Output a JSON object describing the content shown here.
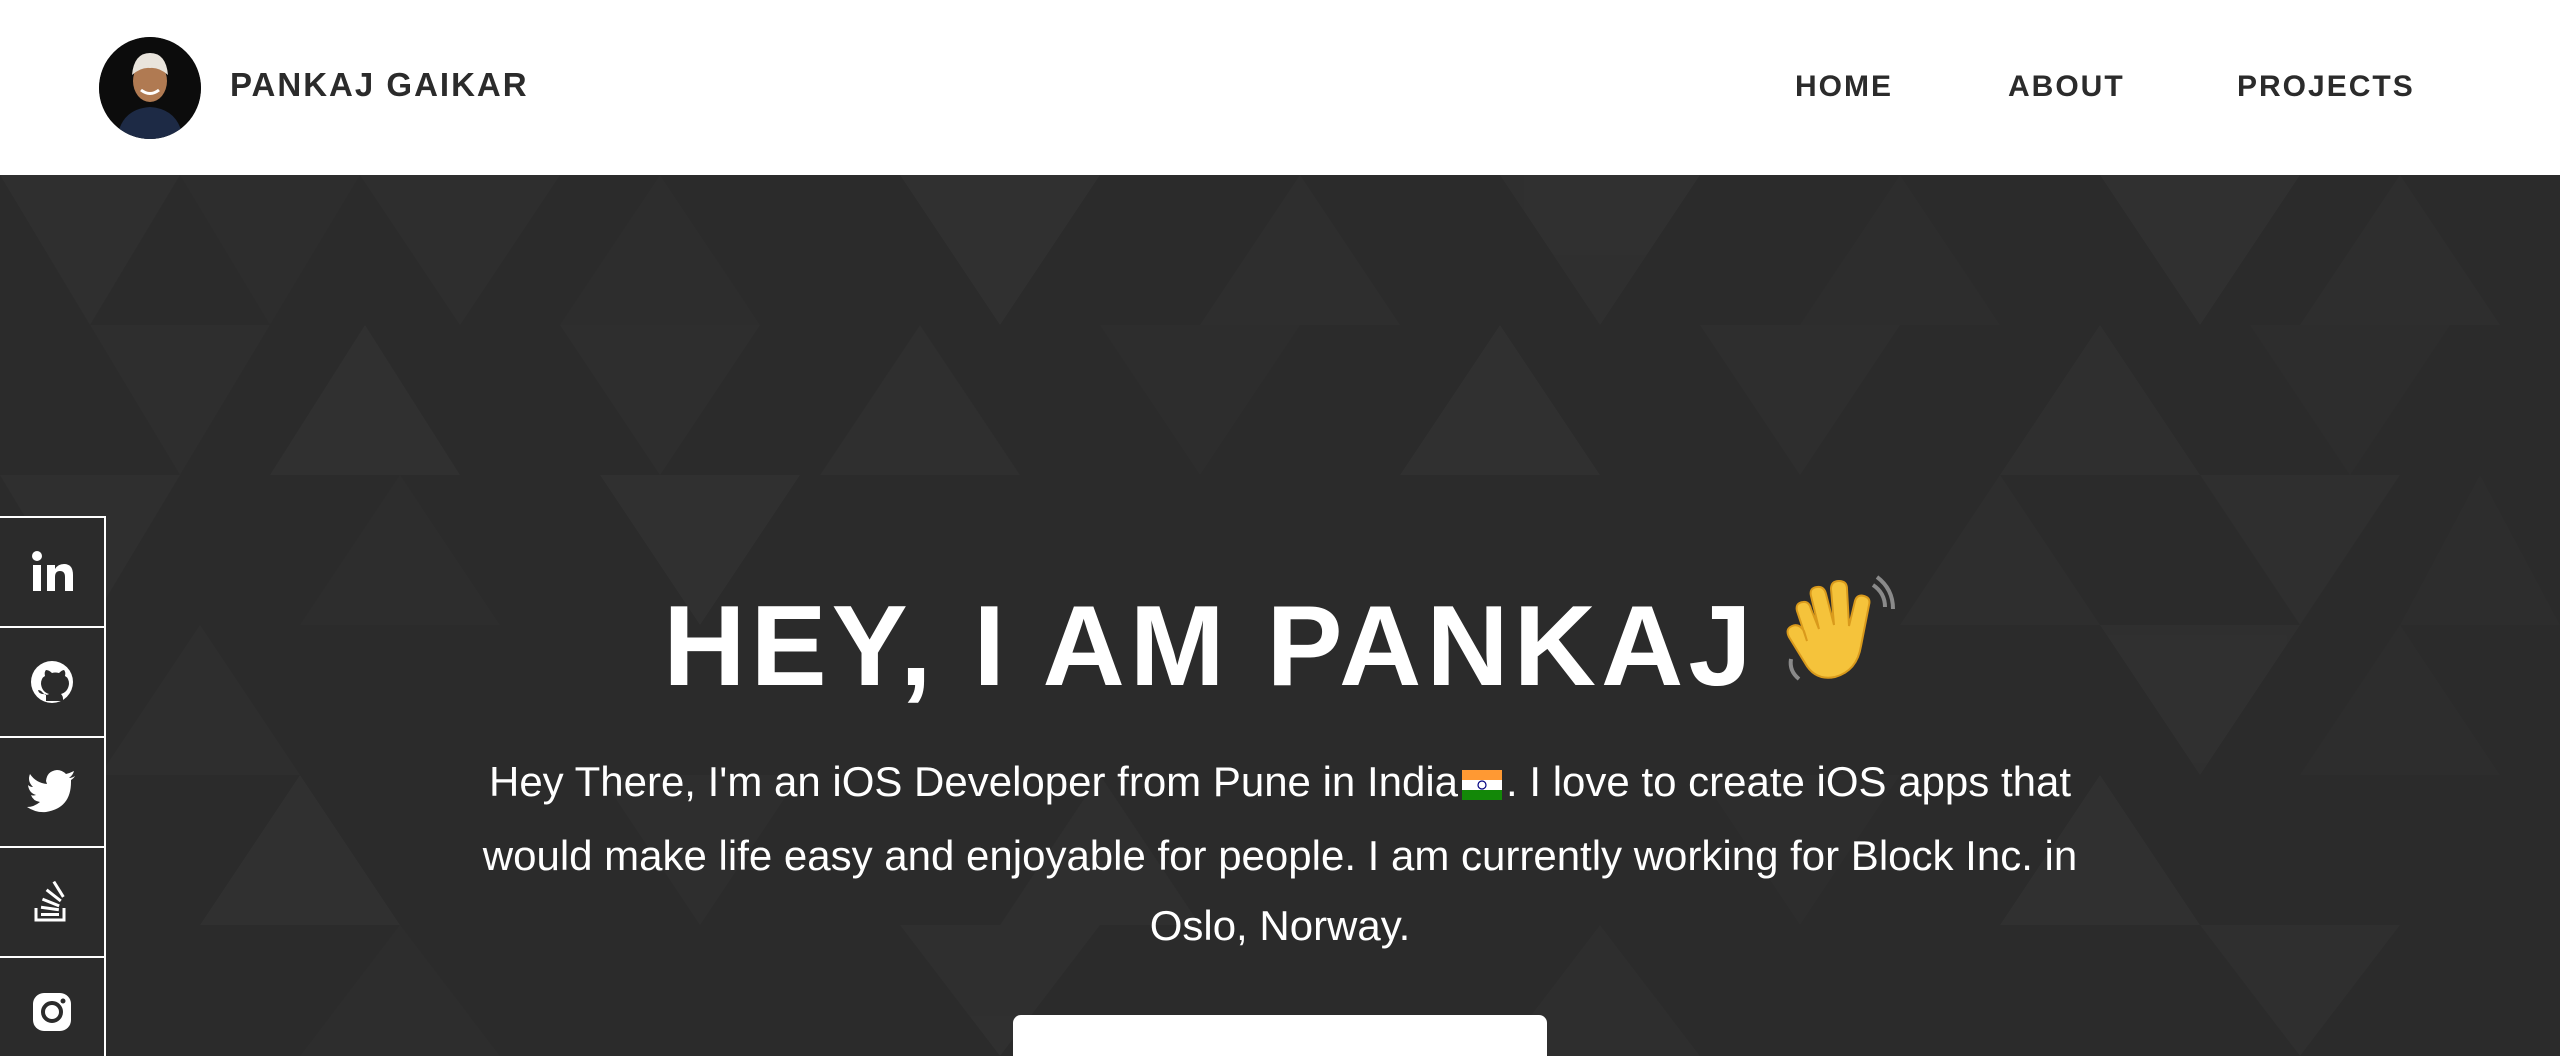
{
  "header": {
    "brand": "PANKAJ GAIKAR",
    "nav": [
      {
        "label": "HOME"
      },
      {
        "label": "ABOUT"
      },
      {
        "label": "PROJECTS"
      }
    ]
  },
  "hero": {
    "title": "HEY, I AM PANKAJ",
    "title_icon": "waving-hand-icon",
    "description_before_flag": "Hey There, I'm an iOS Developer from Pune in India",
    "flag_icon": "india-flag-icon",
    "description_after_flag": ". I love to create iOS apps that would make life easy and enjoyable for people. I am currently working for Block Inc. in Oslo, Norway."
  },
  "social": [
    {
      "icon": "linkedin-icon"
    },
    {
      "icon": "github-icon"
    },
    {
      "icon": "twitter-icon"
    },
    {
      "icon": "stackoverflow-icon"
    },
    {
      "icon": "instagram-icon"
    }
  ],
  "colors": {
    "hero_background": "#2b2b2b",
    "header_text": "#2b2b2b",
    "hero_text": "#ffffff"
  }
}
